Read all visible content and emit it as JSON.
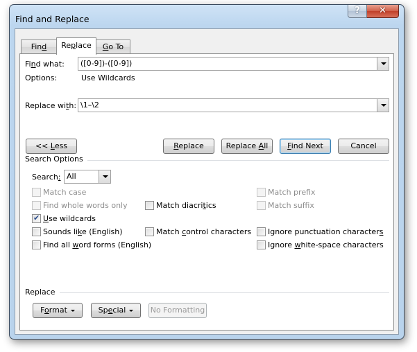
{
  "window": {
    "title": "Find and Replace",
    "help_glyph": "?",
    "close_glyph": "✕"
  },
  "tabs": [
    {
      "label_pre": "Fin",
      "label_u": "d",
      "label_post": "",
      "active": false
    },
    {
      "label_pre": "Re",
      "label_u": "p",
      "label_post": "lace",
      "active": true
    },
    {
      "label_pre": "",
      "label_u": "G",
      "label_post": "o To",
      "active": false
    }
  ],
  "find": {
    "label_pre": "Fi",
    "label_u": "n",
    "label_post": "d what:",
    "value": "([0-9])-([0-9])"
  },
  "options": {
    "label": "Options:",
    "value": "Use Wildcards"
  },
  "replace": {
    "label_pre": "Replace wi",
    "label_u": "t",
    "label_post": "h:",
    "value": "\\1–\\2"
  },
  "buttons": {
    "less": {
      "pre": "<< ",
      "u": "L",
      "post": "ess"
    },
    "replace": {
      "pre": "",
      "u": "R",
      "post": "eplace"
    },
    "replace_all": {
      "pre": "Replace ",
      "u": "A",
      "post": "ll"
    },
    "find_next": {
      "pre": "",
      "u": "F",
      "post": "ind Next"
    },
    "cancel": {
      "pre": "Cancel",
      "u": "",
      "post": ""
    }
  },
  "search_options": {
    "title": "Search Options",
    "search_label_pre": "Search",
    "search_label_u": ":",
    "search_label_post": "",
    "search_value": "All",
    "checkboxes": {
      "match_case": {
        "pre": "Matc",
        "u": "h",
        "post": " case",
        "checked": false,
        "disabled": true
      },
      "whole_words": {
        "pre": "Find wh",
        "u": "o",
        "post": "le words only",
        "checked": false,
        "disabled": true
      },
      "use_wildcards": {
        "pre": "",
        "u": "U",
        "post": "se wildcards",
        "checked": true,
        "disabled": false
      },
      "sounds_like": {
        "pre": "Sounds li",
        "u": "k",
        "post": "e (English)",
        "checked": false,
        "disabled": false
      },
      "word_forms": {
        "pre": "Find all ",
        "u": "w",
        "post": "ord forms (English)",
        "checked": false,
        "disabled": false
      },
      "match_diacritics": {
        "pre": "Match diacri",
        "u": "t",
        "post": "ics",
        "checked": false,
        "disabled": false
      },
      "match_control": {
        "pre": "Match ",
        "u": "c",
        "post": "ontrol characters",
        "checked": false,
        "disabled": false
      },
      "match_prefix": {
        "pre": "Match prefi",
        "u": "x",
        "post": "",
        "checked": false,
        "disabled": true
      },
      "match_suffix": {
        "pre": "Match suffi",
        "u": "x",
        "post": "",
        "checked": false,
        "disabled": true
      },
      "ignore_punct": {
        "pre": "Ignore punctuation character",
        "u": "s",
        "post": "",
        "checked": false,
        "disabled": false
      },
      "ignore_space": {
        "pre": "Ignore ",
        "u": "w",
        "post": "hite-space characters",
        "checked": false,
        "disabled": false
      }
    }
  },
  "replace_group": {
    "title": "Replace",
    "format": {
      "pre": "F",
      "u": "o",
      "post": "rmat"
    },
    "special": {
      "pre": "Sp",
      "u": "e",
      "post": "cial"
    },
    "no_formatting": "No Formatting"
  }
}
